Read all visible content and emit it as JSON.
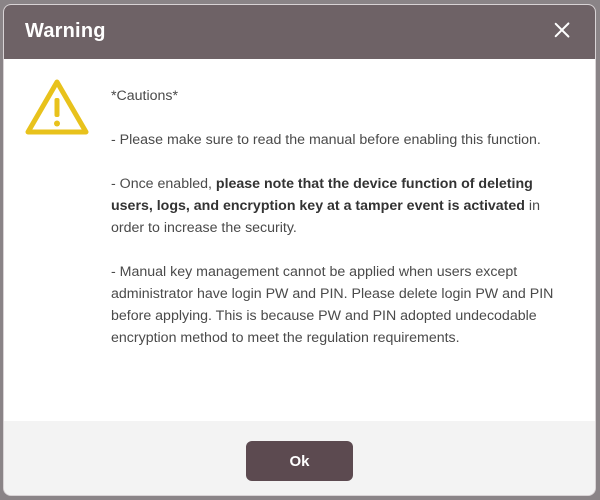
{
  "dialog": {
    "title": "Warning",
    "close_icon": "close-icon",
    "warning_icon": "warning-triangle-icon",
    "heading": "*Cautions*",
    "para1": "- Please make sure to read the manual before enabling this function.",
    "para2": {
      "prefix": "- Once enabled, ",
      "bold": "please note that the device function of deleting users, logs, and encryption key at a tamper event is activated",
      "suffix": " in order to increase the security."
    },
    "para3": "- Manual key management cannot be applied when users except administrator have login PW and PIN. Please delete login PW and PIN before applying. This is because PW and PIN adopted undecodable encryption method to meet the regulation requirements.",
    "ok_label": "Ok"
  },
  "colors": {
    "titlebar": "#6e6266",
    "button": "#5c4a50",
    "warning_icon": "#e8c21c",
    "overlay": "#8a8487"
  }
}
